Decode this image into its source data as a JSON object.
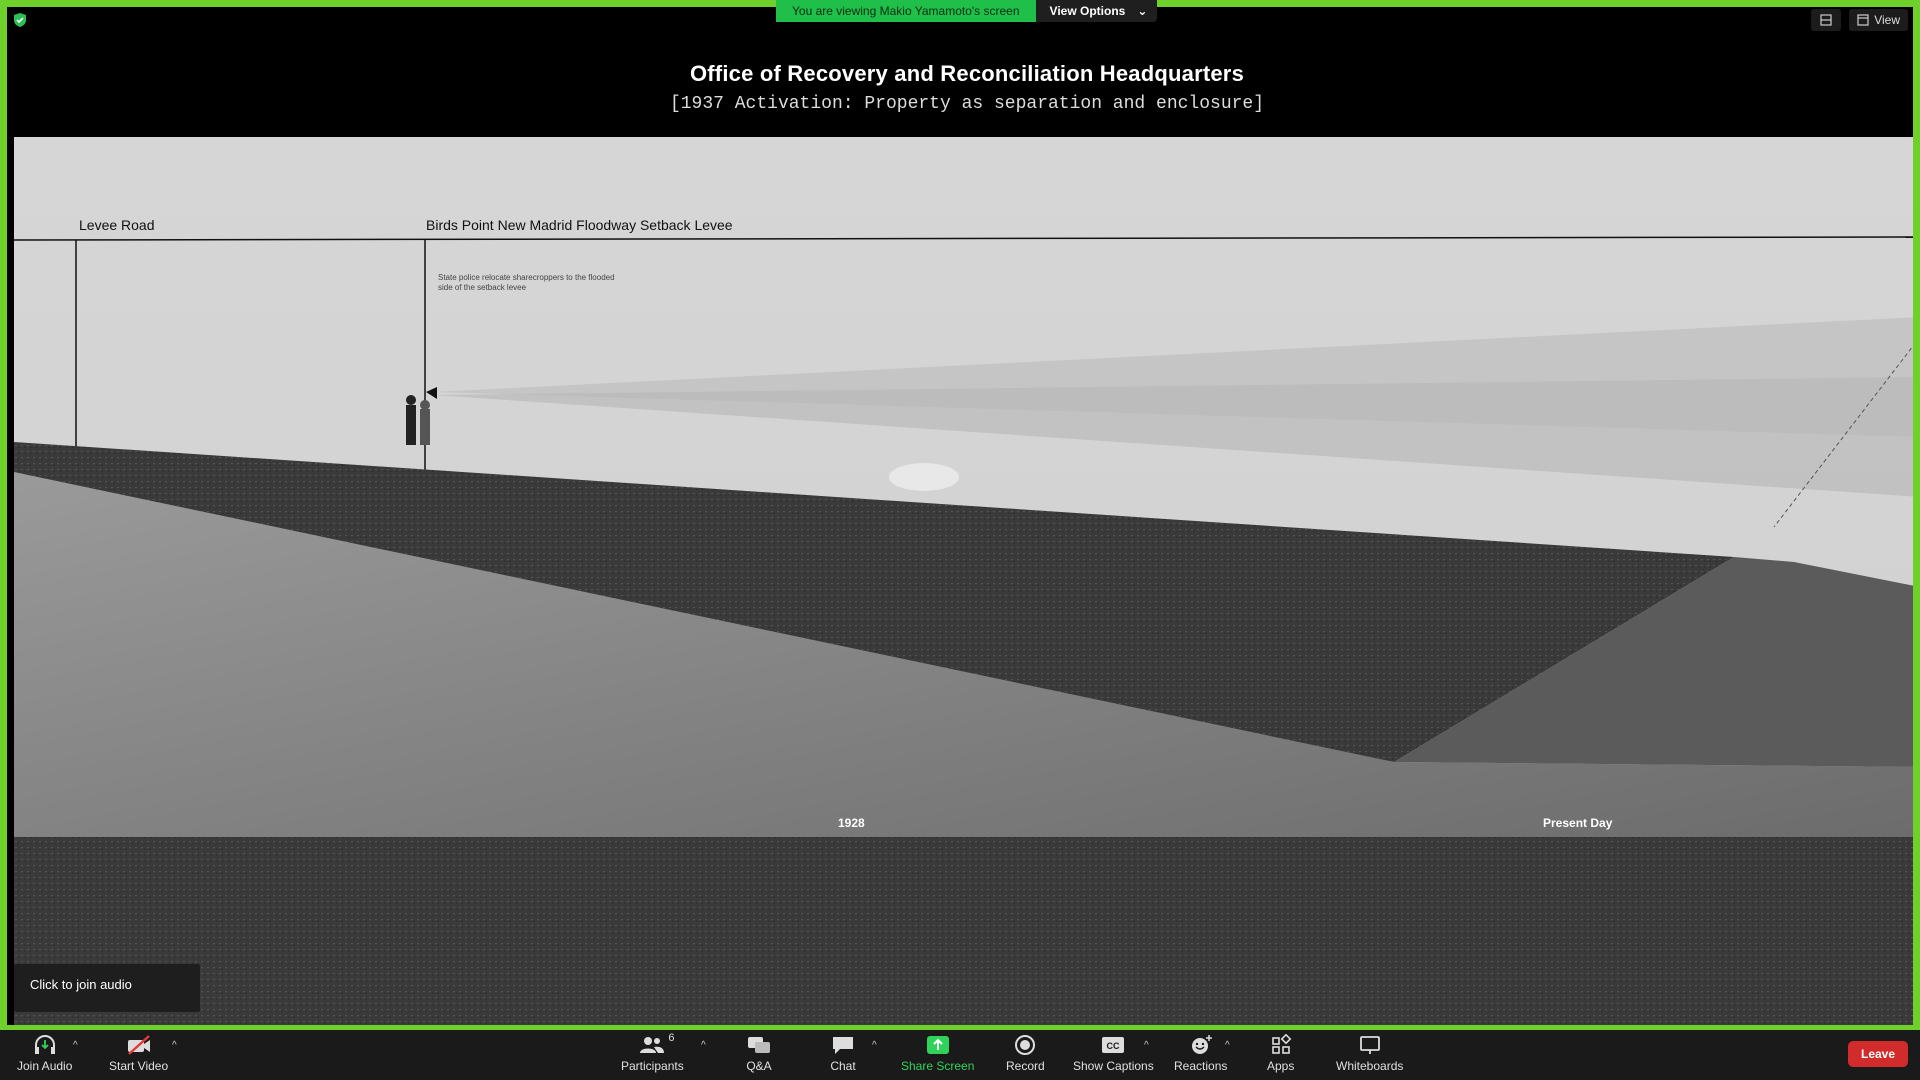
{
  "banner": {
    "viewing": "You are viewing Makio Yamamoto's screen",
    "options": "View Options"
  },
  "top_right": {
    "view": "View"
  },
  "slide": {
    "title": "Office of Recovery and Reconciliation  Headquarters",
    "subtitle": "[1937 Activation: Property as separation and enclosure]"
  },
  "scene": {
    "label_levee_road": "Levee Road",
    "label_setback": "Birds Point New Madrid Floodway Setback Levee",
    "note": "State police relocate sharecroppers to the flooded side of the setback levee",
    "year_1928": "1928",
    "year_present": "Present Day"
  },
  "tooltip": {
    "join_audio": "Click to join audio"
  },
  "toolbar": {
    "join_audio": "Join Audio",
    "start_video": "Start Video",
    "participants": "Participants",
    "participants_count": "6",
    "qa": "Q&A",
    "chat": "Chat",
    "share_screen": "Share Screen",
    "record": "Record",
    "show_captions": "Show Captions",
    "reactions": "Reactions",
    "apps": "Apps",
    "whiteboards": "Whiteboards",
    "leave": "Leave"
  }
}
